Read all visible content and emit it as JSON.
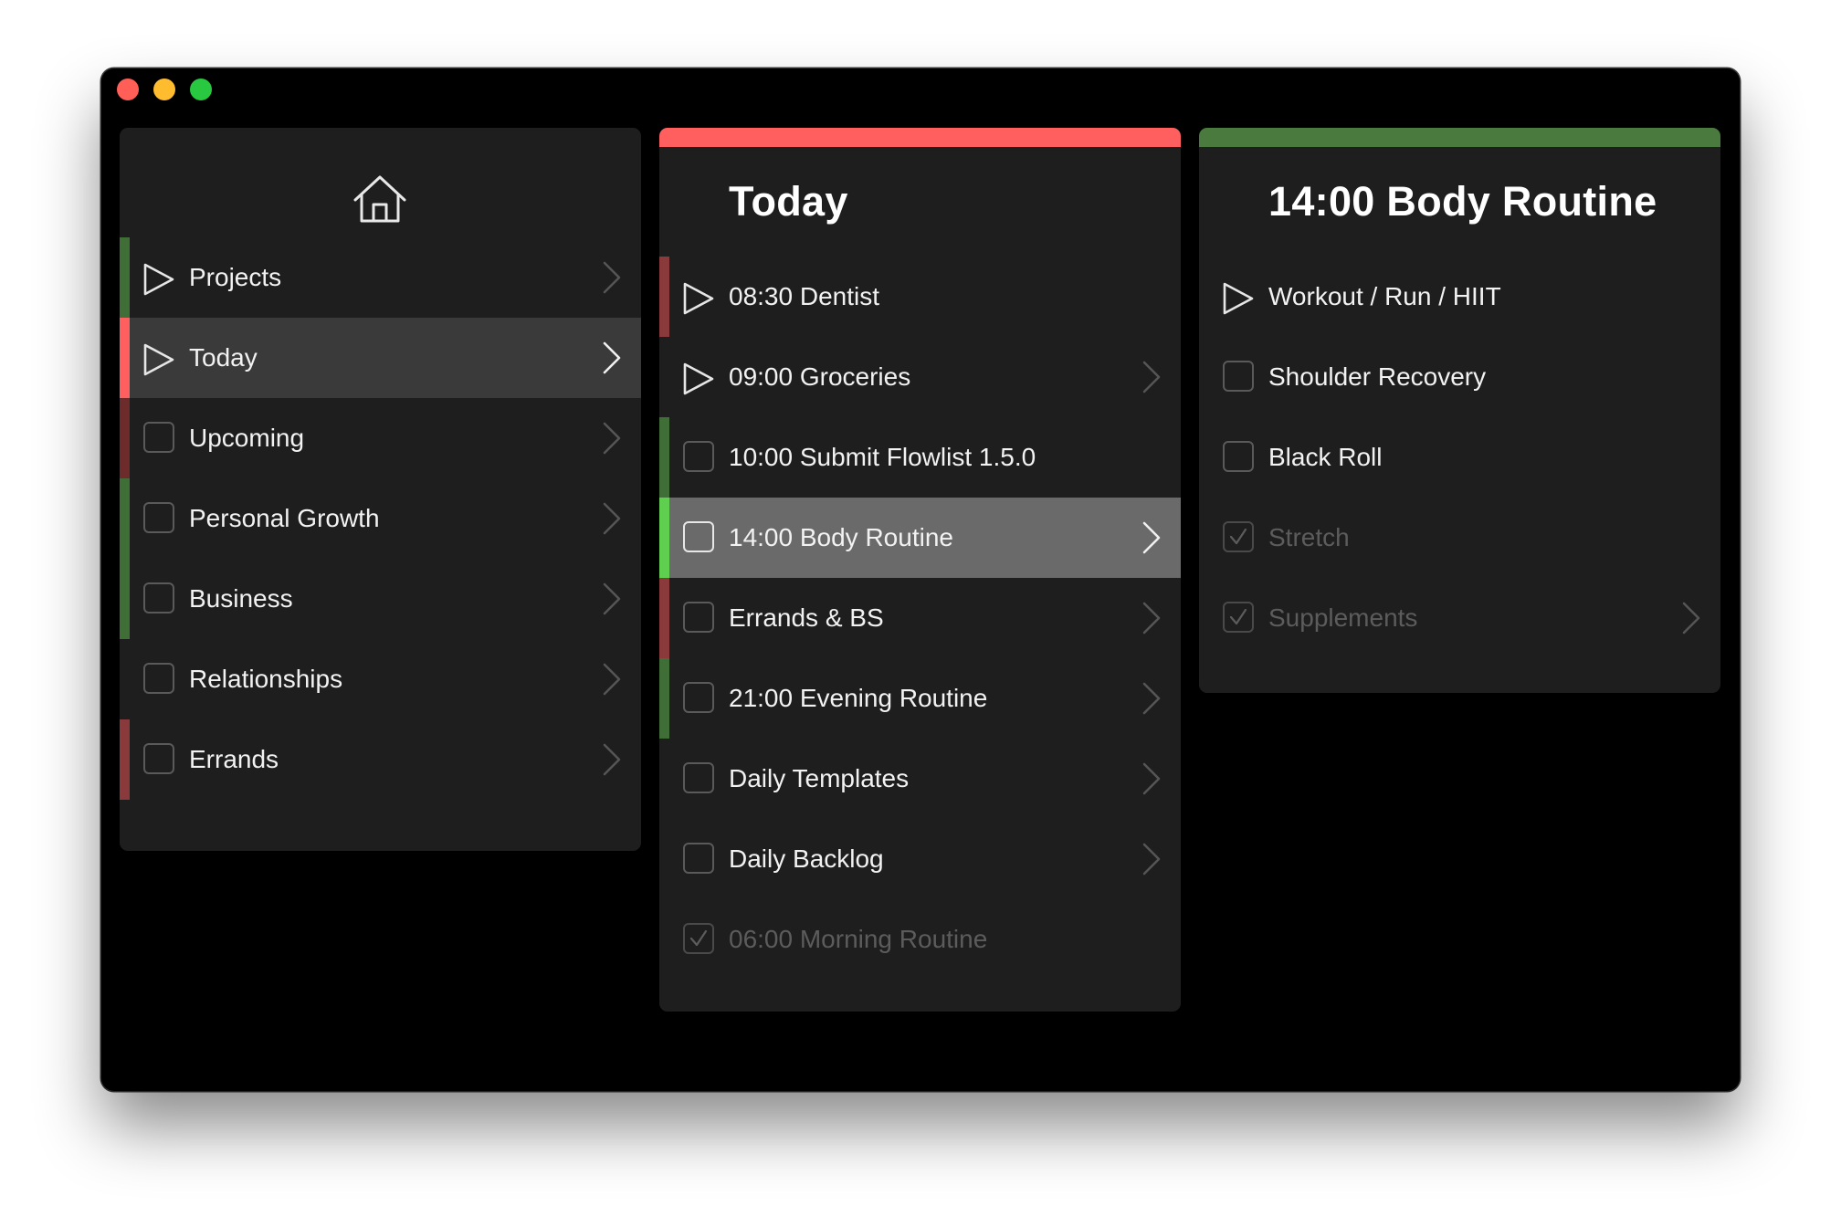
{
  "colors": {
    "red_accent": "#ff5f5f",
    "green_accent": "#4a7a3e",
    "dark_red": "#7a2e2e",
    "green_stripe": "#3f6e36",
    "bright_green": "#5fcf4f"
  },
  "sidebar": {
    "home_icon": "home-icon",
    "items": [
      {
        "label": "Projects",
        "icon": "play-icon",
        "stripe": "#3f6e36",
        "chevron": true
      },
      {
        "label": "Today",
        "icon": "play-icon",
        "stripe": "#ff5f5f",
        "chevron": true,
        "selected": true
      },
      {
        "label": "Upcoming",
        "icon": "checkbox",
        "stripe": "#6e2b2b",
        "chevron": true
      },
      {
        "label": "Personal Growth",
        "icon": "checkbox",
        "stripe": "#3f6e36",
        "chevron": true
      },
      {
        "label": "Business",
        "icon": "checkbox",
        "stripe": "#3f6e36",
        "chevron": true
      },
      {
        "label": "Relationships",
        "icon": "checkbox",
        "stripe": "",
        "chevron": true
      },
      {
        "label": "Errands",
        "icon": "checkbox",
        "stripe": "#8a3a3a",
        "chevron": true
      }
    ]
  },
  "today": {
    "title": "Today",
    "accent": "#ff5f5f",
    "items": [
      {
        "label": "08:30 Dentist",
        "icon": "play-icon",
        "stripe": "#8a3a3a",
        "chevron": false
      },
      {
        "label": "09:00 Groceries",
        "icon": "play-icon",
        "stripe": "",
        "chevron": true
      },
      {
        "label": "10:00 Submit Flowlist 1.5.0",
        "icon": "checkbox",
        "stripe": "#3f6e36",
        "chevron": false
      },
      {
        "label": "14:00 Body Routine",
        "icon": "checkbox",
        "stripe": "#5fcf4f",
        "chevron": true,
        "selected": true
      },
      {
        "label": "Errands & BS",
        "icon": "checkbox",
        "stripe": "#8a3a3a",
        "chevron": true
      },
      {
        "label": "21:00 Evening Routine",
        "icon": "checkbox",
        "stripe": "#3f6e36",
        "chevron": true
      },
      {
        "label": "Daily Templates",
        "icon": "checkbox",
        "stripe": "",
        "chevron": true
      },
      {
        "label": "Daily Backlog",
        "icon": "checkbox",
        "stripe": "",
        "chevron": true
      },
      {
        "label": "06:00 Morning Routine",
        "icon": "checked-box",
        "stripe": "",
        "chevron": false,
        "done": true
      }
    ]
  },
  "detail": {
    "title": "14:00 Body Routine",
    "accent": "#4a7a3e",
    "items": [
      {
        "label": "Workout / Run / HIIT",
        "icon": "play-icon",
        "stripe": "",
        "chevron": false
      },
      {
        "label": "Shoulder Recovery",
        "icon": "checkbox",
        "stripe": "",
        "chevron": false
      },
      {
        "label": "Black Roll",
        "icon": "checkbox",
        "stripe": "",
        "chevron": false
      },
      {
        "label": "Stretch",
        "icon": "checked-box",
        "stripe": "",
        "chevron": false,
        "done": true
      },
      {
        "label": "Supplements",
        "icon": "checked-box",
        "stripe": "",
        "chevron": true,
        "done": true
      }
    ]
  }
}
